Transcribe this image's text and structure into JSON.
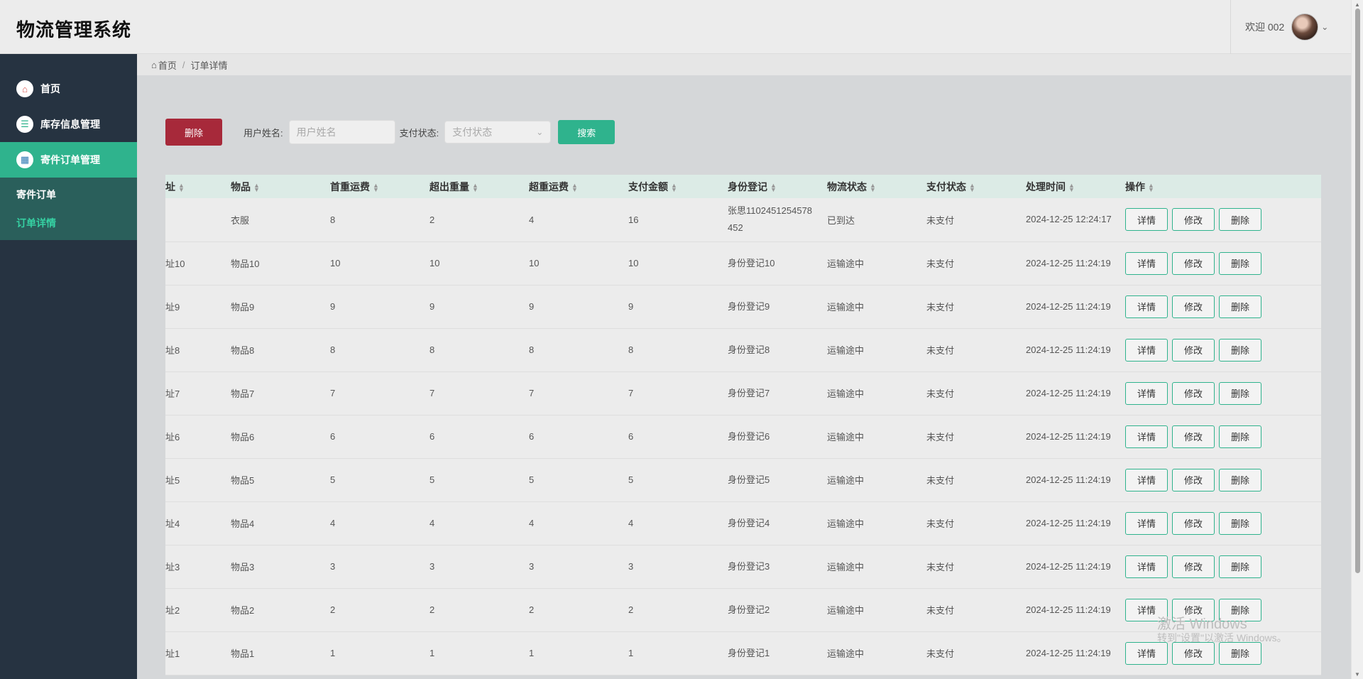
{
  "header": {
    "title": "物流管理系统",
    "welcome": "欢迎 002"
  },
  "sidebar": {
    "items": [
      {
        "label": "首页",
        "icon": "home-icon"
      },
      {
        "label": "库存信息管理",
        "icon": "database-icon"
      },
      {
        "label": "寄件订单管理",
        "icon": "calendar-icon"
      }
    ],
    "sub_items": [
      {
        "label": "寄件订单"
      },
      {
        "label": "订单详情"
      }
    ]
  },
  "breadcrumb": {
    "home": "首页",
    "sep": "/",
    "current": "订单详情"
  },
  "toolbar": {
    "delete_label": "删除",
    "username_label": "用户姓名:",
    "username_placeholder": "用户姓名",
    "pay_status_label": "支付状态:",
    "pay_status_placeholder": "支付状态",
    "search_label": "搜索"
  },
  "table": {
    "columns": [
      "址",
      "物品",
      "首重运费",
      "超出重量",
      "超重运费",
      "支付金额",
      "身份登记",
      "物流状态",
      "支付状态",
      "处理时间",
      "操作"
    ],
    "actions": {
      "detail": "详情",
      "edit": "修改",
      "delete": "删除"
    },
    "rows": [
      {
        "addr": "",
        "item": "衣服",
        "first_fee": "8",
        "over_weight": "2",
        "over_fee": "4",
        "pay_amount": "16",
        "identity": "张思1102451254578452",
        "logistics": "已到达",
        "pay_status": "未支付",
        "time": "2024-12-25 12:24:17"
      },
      {
        "addr": "址10",
        "item": "物品10",
        "first_fee": "10",
        "over_weight": "10",
        "over_fee": "10",
        "pay_amount": "10",
        "identity": "身份登记10",
        "logistics": "运输途中",
        "pay_status": "未支付",
        "time": "2024-12-25 11:24:19"
      },
      {
        "addr": "址9",
        "item": "物品9",
        "first_fee": "9",
        "over_weight": "9",
        "over_fee": "9",
        "pay_amount": "9",
        "identity": "身份登记9",
        "logistics": "运输途中",
        "pay_status": "未支付",
        "time": "2024-12-25 11:24:19"
      },
      {
        "addr": "址8",
        "item": "物品8",
        "first_fee": "8",
        "over_weight": "8",
        "over_fee": "8",
        "pay_amount": "8",
        "identity": "身份登记8",
        "logistics": "运输途中",
        "pay_status": "未支付",
        "time": "2024-12-25 11:24:19"
      },
      {
        "addr": "址7",
        "item": "物品7",
        "first_fee": "7",
        "over_weight": "7",
        "over_fee": "7",
        "pay_amount": "7",
        "identity": "身份登记7",
        "logistics": "运输途中",
        "pay_status": "未支付",
        "time": "2024-12-25 11:24:19"
      },
      {
        "addr": "址6",
        "item": "物品6",
        "first_fee": "6",
        "over_weight": "6",
        "over_fee": "6",
        "pay_amount": "6",
        "identity": "身份登记6",
        "logistics": "运输途中",
        "pay_status": "未支付",
        "time": "2024-12-25 11:24:19"
      },
      {
        "addr": "址5",
        "item": "物品5",
        "first_fee": "5",
        "over_weight": "5",
        "over_fee": "5",
        "pay_amount": "5",
        "identity": "身份登记5",
        "logistics": "运输途中",
        "pay_status": "未支付",
        "time": "2024-12-25 11:24:19"
      },
      {
        "addr": "址4",
        "item": "物品4",
        "first_fee": "4",
        "over_weight": "4",
        "over_fee": "4",
        "pay_amount": "4",
        "identity": "身份登记4",
        "logistics": "运输途中",
        "pay_status": "未支付",
        "time": "2024-12-25 11:24:19"
      },
      {
        "addr": "址3",
        "item": "物品3",
        "first_fee": "3",
        "over_weight": "3",
        "over_fee": "3",
        "pay_amount": "3",
        "identity": "身份登记3",
        "logistics": "运输途中",
        "pay_status": "未支付",
        "time": "2024-12-25 11:24:19"
      },
      {
        "addr": "址2",
        "item": "物品2",
        "first_fee": "2",
        "over_weight": "2",
        "over_fee": "2",
        "pay_amount": "2",
        "identity": "身份登记2",
        "logistics": "运输途中",
        "pay_status": "未支付",
        "time": "2024-12-25 11:24:19"
      },
      {
        "addr": "址1",
        "item": "物品1",
        "first_fee": "1",
        "over_weight": "1",
        "over_fee": "1",
        "pay_amount": "1",
        "identity": "身份登记1",
        "logistics": "运输途中",
        "pay_status": "未支付",
        "time": "2024-12-25 11:24:19"
      }
    ]
  },
  "watermark": {
    "line1": "激活 Windows",
    "line2": "转到\"设置\"以激活 Windows。"
  },
  "colors": {
    "sidebar_bg": "#263341",
    "accent": "#2fb38d",
    "danger": "#a7293a"
  }
}
